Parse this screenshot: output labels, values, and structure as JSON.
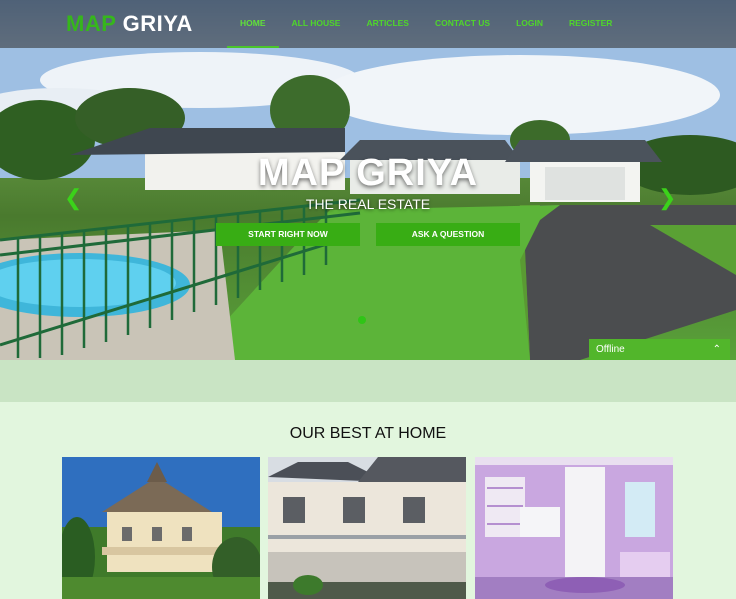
{
  "brand": {
    "part1": "MAP",
    "part2": "GRIYA"
  },
  "nav": [
    "HOME",
    "ALL HOUSE",
    "ARTICLES",
    "CONTACT US",
    "LOGIN",
    "REGISTER"
  ],
  "hero": {
    "title": "MAP GRIYA",
    "subtitle": "THE REAL ESTATE",
    "cta_primary": "START RIGHT NOW",
    "cta_secondary": "ASK A QUESTION",
    "arrows": {
      "prev": "chevron-left-icon",
      "next": "chevron-right-icon"
    }
  },
  "chat": {
    "status": "Offline",
    "icon": "chevron-up-icon"
  },
  "section": {
    "title": "OUR BEST AT HOME"
  },
  "colors": {
    "brand_green": "#36b61c",
    "nav_green": "#4fd62b",
    "button_green": "#38ad14",
    "section_bg": "#e2f6de"
  }
}
